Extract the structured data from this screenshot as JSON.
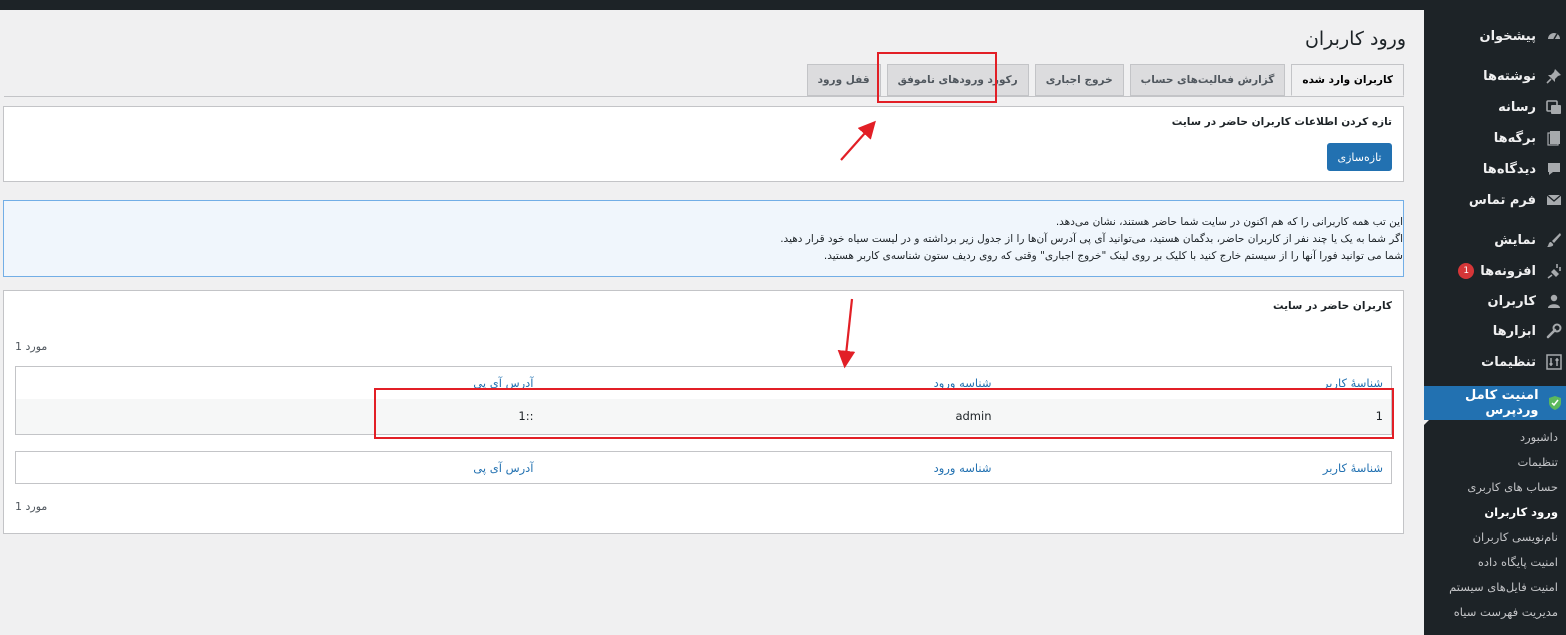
{
  "sidebar": {
    "items": [
      {
        "label": "پیشخوان",
        "icon": "dashboard-icon"
      },
      {
        "label": "نوشته‌ها",
        "icon": "pin-icon"
      },
      {
        "label": "رسانه",
        "icon": "media-icon"
      },
      {
        "label": "برگه‌ها",
        "icon": "pages-icon"
      },
      {
        "label": "دیدگاه‌ها",
        "icon": "comments-icon"
      },
      {
        "label": "فرم تماس",
        "icon": "mail-icon"
      },
      {
        "label": "نمایش",
        "icon": "appearance-icon"
      },
      {
        "label": "افزونه‌ها",
        "icon": "plugins-icon",
        "badge": "1"
      },
      {
        "label": "کاربران",
        "icon": "users-icon"
      },
      {
        "label": "ابزارها",
        "icon": "tools-icon"
      },
      {
        "label": "تنظیمات",
        "icon": "settings-icon"
      },
      {
        "label": "امنیت کامل وردپرس",
        "icon": "shield-icon",
        "active": true
      }
    ],
    "submenu": [
      {
        "label": "داشبورد"
      },
      {
        "label": "تنظیمات"
      },
      {
        "label": "حساب های کاربری"
      },
      {
        "label": "ورود کاربران",
        "current": true
      },
      {
        "label": "نام‌نویسی کاربران"
      },
      {
        "label": "امنیت پایگاه داده"
      },
      {
        "label": "امنیت فایل‌های سیستم"
      },
      {
        "label": "مدیریت فهرست سیاه"
      }
    ]
  },
  "page": {
    "title": "ورود کاربران"
  },
  "tabs": [
    {
      "label": "قفل ورود"
    },
    {
      "label": "رکورد ورودهای ناموفق"
    },
    {
      "label": "خروج اجباری"
    },
    {
      "label": "گزارش فعالیت‌های حساب"
    },
    {
      "label": "کاربران وارد شده",
      "active": true
    }
  ],
  "refresh_panel": {
    "title": "تازه کردن اطلاعات کاربران حاضر در سایت",
    "button_label": "تازه‌سازی"
  },
  "notice": {
    "lines": [
      "این تب همه کاربرانی را که هم اکنون در سایت شما حاضر هستند، نشان می‌دهد.",
      "اگر شما به یک یا چند نفر از کاربران حاضر، بدگمان هستید، می‌توانید آی پی آدرس آن‌ها را از جدول زیر برداشته و در لیست سیاه خود قرار دهید.",
      "شما می توانید فورا آنها را از سیستم خارج کنید با کلیک بر روی لینک \"خروج اجباری\" وقتی که روی ردیف ستون شناسه‌ی کاربر هستید."
    ]
  },
  "users_panel": {
    "title": "کاربران حاضر در سایت",
    "count_top": "1 مورد",
    "count_bottom": "1 مورد",
    "columns": [
      "شناسهٔ کاربر",
      "شناسه ورود",
      "آدرس آی پی"
    ],
    "rows": [
      {
        "user_id": "1",
        "login": "admin",
        "ip": "::1"
      }
    ]
  }
}
